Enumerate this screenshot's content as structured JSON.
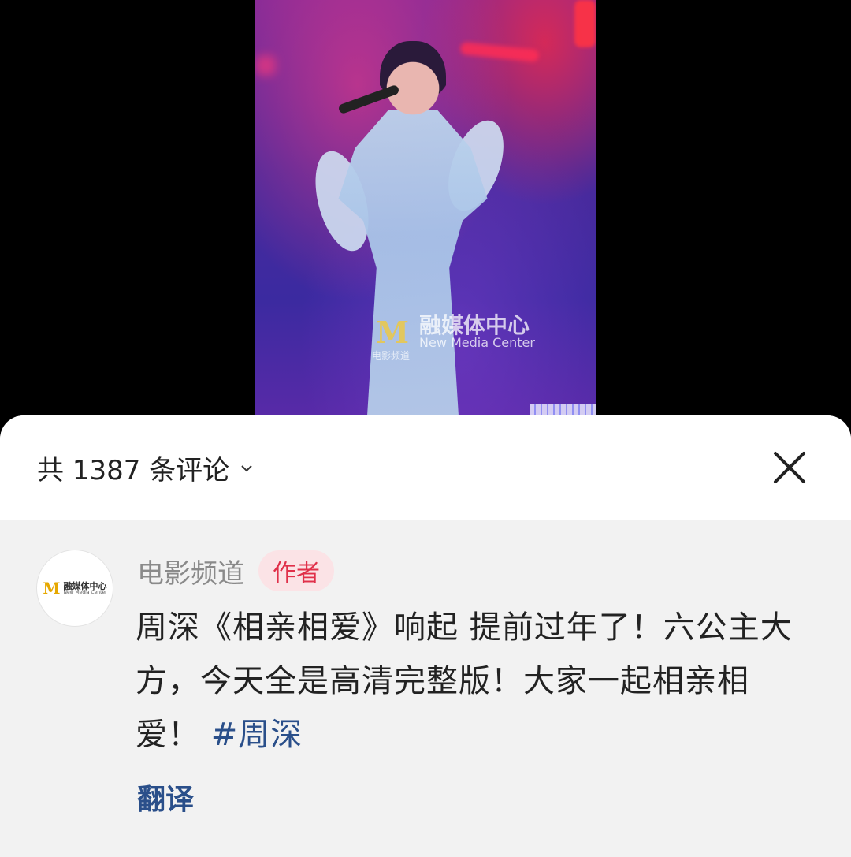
{
  "video": {
    "watermark_cn": "融媒体中心",
    "watermark_en": "New Media Center",
    "watermark_sub": "电影频道"
  },
  "comments_header": {
    "count_label": "共 1387 条评论"
  },
  "comment": {
    "avatar_cn": "融媒体中心",
    "avatar_en": "New Media Center",
    "author": "电影频道",
    "author_tag": "作者",
    "text": "周深《相亲相爱》响起 提前过年了！六公主大方，今天全是高清完整版！大家一起相亲相爱！",
    "hashtag": "#周深",
    "translate_label": "翻译"
  },
  "colors": {
    "author_tag": "#e0304a",
    "link": "#2a4f8a"
  }
}
